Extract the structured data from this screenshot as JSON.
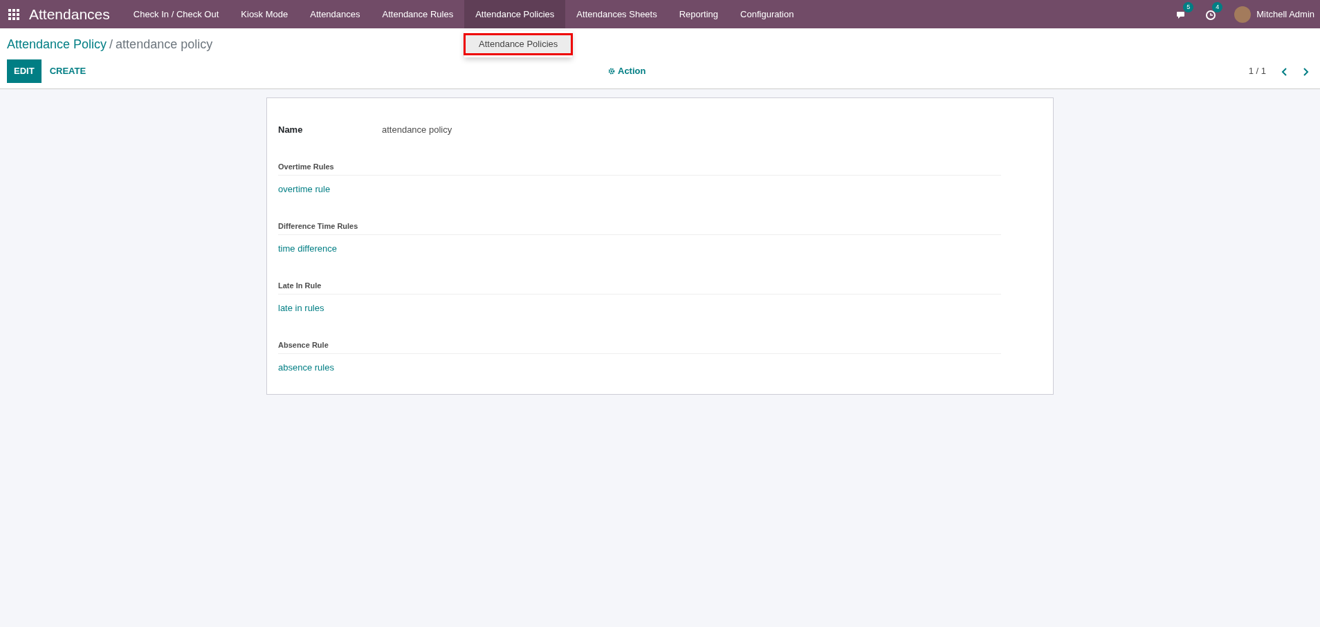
{
  "app": {
    "title": "Attendances"
  },
  "menu": [
    {
      "label": "Check In / Check Out",
      "selected": false
    },
    {
      "label": "Kiosk Mode",
      "selected": false
    },
    {
      "label": "Attendances",
      "selected": false
    },
    {
      "label": "Attendance Rules",
      "selected": false
    },
    {
      "label": "Attendance Policies",
      "selected": true,
      "dropdown": [
        {
          "label": "Attendance Policies",
          "selected": true
        }
      ]
    },
    {
      "label": "Attendances Sheets",
      "selected": false
    },
    {
      "label": "Reporting",
      "selected": false
    },
    {
      "label": "Configuration",
      "selected": false
    }
  ],
  "systray": {
    "messages_count": "5",
    "activities_count": "4",
    "user": "Mitchell Admin"
  },
  "breadcrumb": {
    "parent": "Attendance Policy",
    "separator": "/",
    "current": "attendance policy"
  },
  "buttons": [
    {
      "label": "EDIT",
      "kind": "primary"
    },
    {
      "label": "CREATE",
      "kind": "link"
    }
  ],
  "action": {
    "label": "Action"
  },
  "pager": {
    "text": "1 / 1"
  },
  "form": {
    "name_label": "Name",
    "name_value": "attendance policy",
    "sections": [
      {
        "label": "Overtime Rules",
        "value": "overtime rule"
      },
      {
        "label": "Difference Time Rules",
        "value": "time difference"
      },
      {
        "label": "Late In Rule",
        "value": "late in rules"
      },
      {
        "label": "Absence Rule",
        "value": "absence rules"
      }
    ]
  }
}
